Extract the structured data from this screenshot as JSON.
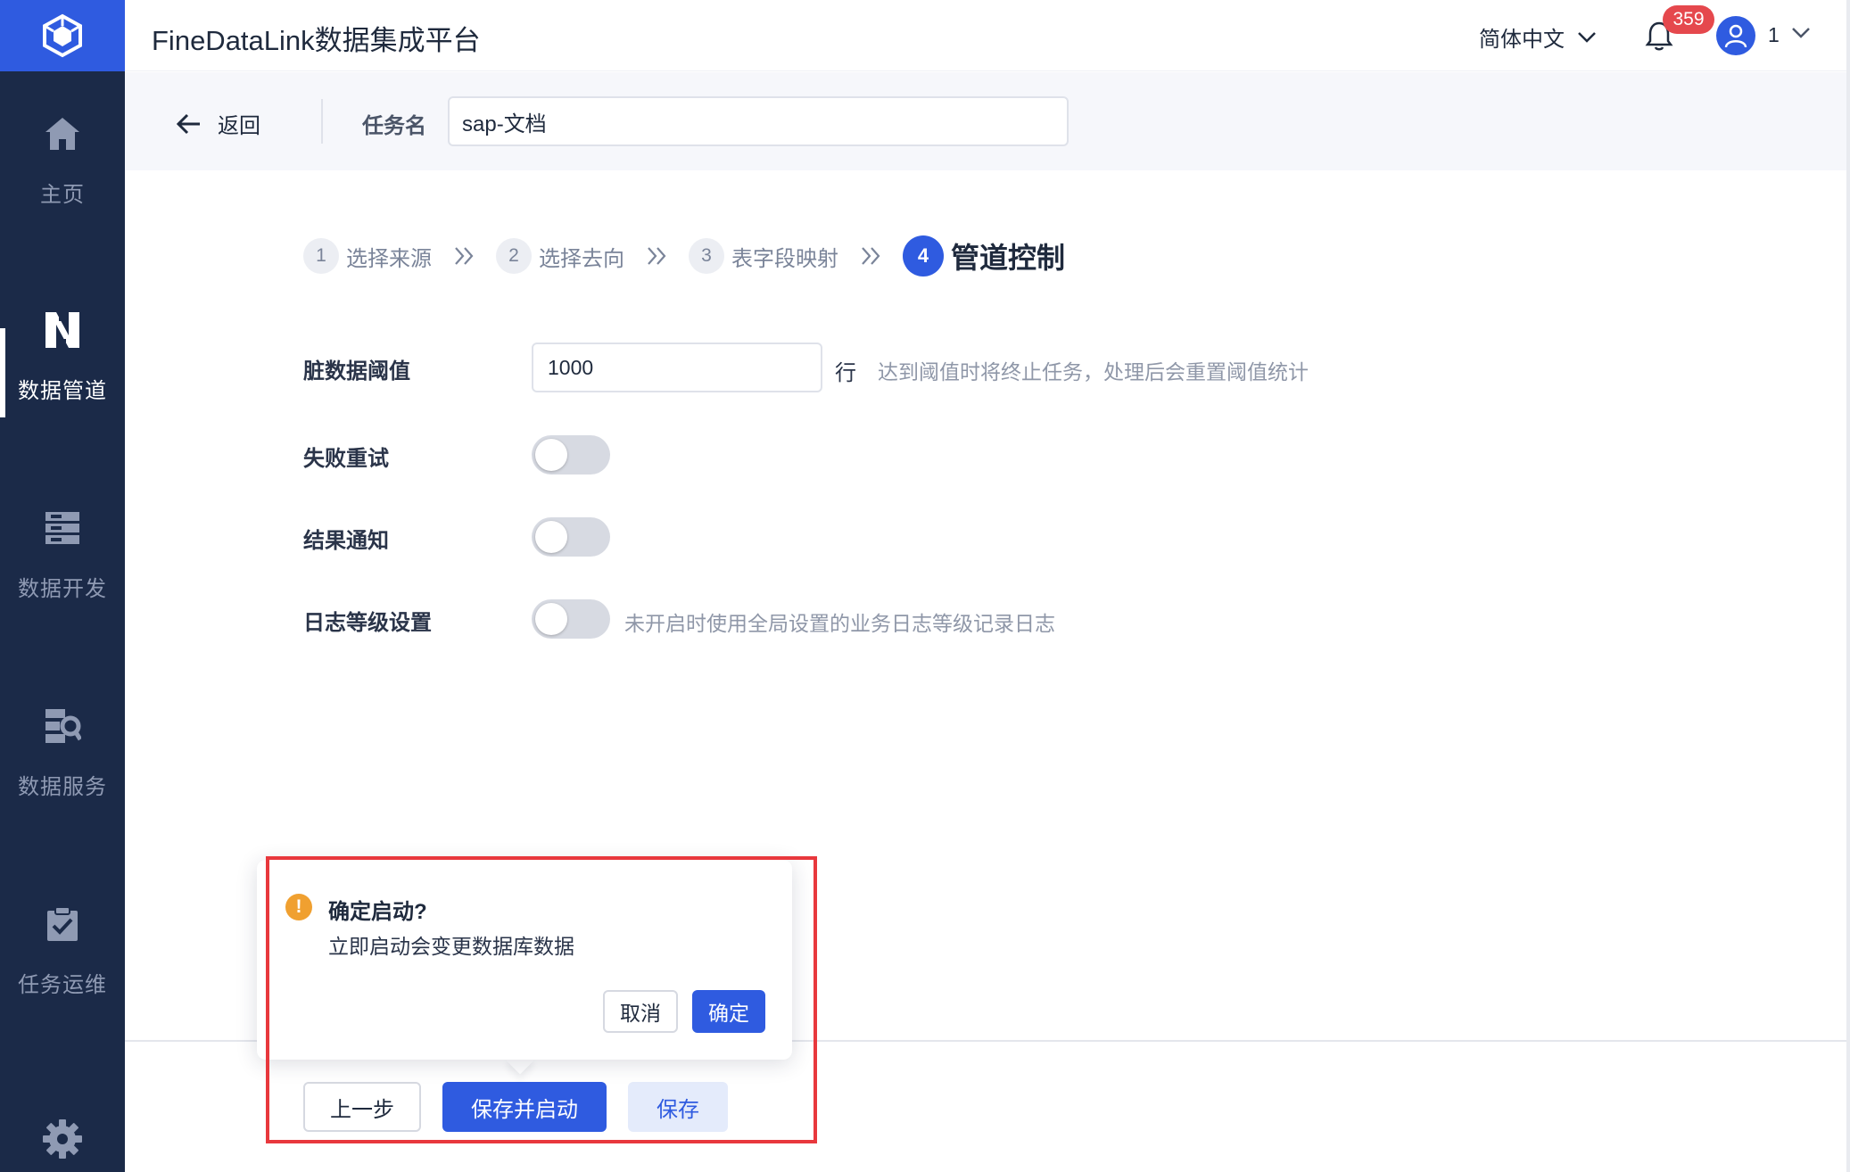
{
  "app": {
    "title": "FineDataLink数据集成平台",
    "brand_color": "#2f5be0",
    "sidebar_color": "#1b2a48"
  },
  "sidebar": {
    "items": [
      {
        "label": "主页",
        "icon": "home-icon"
      },
      {
        "label": "数据管道",
        "icon": "data-pipeline-icon",
        "active": true
      },
      {
        "label": "数据开发",
        "icon": "data-dev-icon"
      },
      {
        "label": "数据服务",
        "icon": "data-service-icon"
      },
      {
        "label": "任务运维",
        "icon": "task-ops-icon"
      }
    ],
    "settings_icon": "gear-icon"
  },
  "topbar": {
    "language": "简体中文",
    "notification_count": "359",
    "user": "1"
  },
  "task_header": {
    "back_label": "返回",
    "task_name_label": "任务名",
    "task_name_value": "sap-文档"
  },
  "steps": [
    {
      "num": "1",
      "label": "选择来源"
    },
    {
      "num": "2",
      "label": "选择去向"
    },
    {
      "num": "3",
      "label": "表字段映射"
    },
    {
      "num": "4",
      "label": "管道控制",
      "current": true
    }
  ],
  "form": {
    "dirty_threshold": {
      "label": "脏数据阈值",
      "value": "1000",
      "unit": "行",
      "hint": "达到阈值时将终止任务，处理后会重置阈值统计"
    },
    "fail_retry": {
      "label": "失败重试",
      "enabled": false
    },
    "result_notify": {
      "label": "结果通知",
      "enabled": false
    },
    "log_level": {
      "label": "日志等级设置",
      "enabled": false,
      "hint": "未开启时使用全局设置的业务日志等级记录日志"
    }
  },
  "footer": {
    "prev_label": "上一步",
    "save_start_label": "保存并启动",
    "save_label": "保存"
  },
  "popconfirm": {
    "title": "确定启动?",
    "body": "立即启动会变更数据库数据",
    "cancel_label": "取消",
    "ok_label": "确定",
    "warning_color": "#f0a030"
  },
  "highlight_color": "#e8383d"
}
